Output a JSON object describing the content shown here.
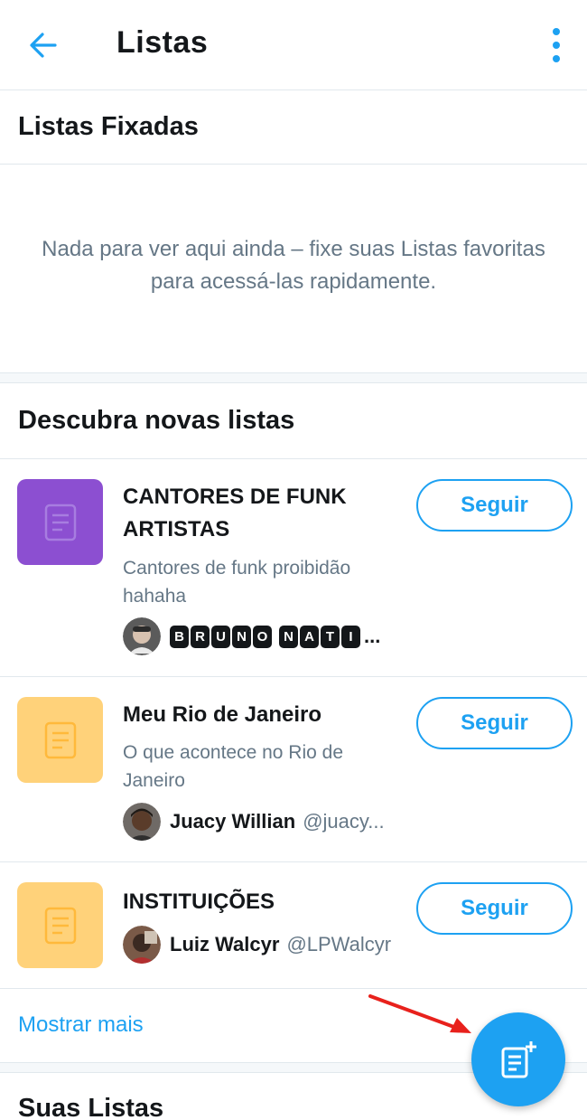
{
  "header": {
    "title": "Listas",
    "back_icon": "back-arrow-icon",
    "menu_icon": "more-vertical-icon"
  },
  "pinned": {
    "title": "Listas Fixadas",
    "empty_message": "Nada para ver aqui ainda – fixe suas Listas favoritas para acessá-las rapidamente."
  },
  "discover": {
    "title": "Descubra novas listas",
    "follow_label": "Seguir",
    "items": [
      {
        "name": "CANTORES DE FUNK ARTISTAS",
        "description": "Cantores de funk proibidão hahaha",
        "owner_letters": [
          "B",
          "R",
          "U",
          "N",
          "O",
          "N",
          "A",
          "T",
          "I"
        ],
        "owner_ellipsis": "...",
        "thumb_color": "#8c4fd1"
      },
      {
        "name": "Meu Rio de Janeiro",
        "description": "O que acontece no Rio de Janeiro",
        "owner_name": "Juacy Willian",
        "owner_handle": "@juacy...",
        "thumb_color": "#ffd27a"
      },
      {
        "name": "INSTITUIÇÕES",
        "owner_name": "Luiz Walcyr",
        "owner_handle": "@LPWalcyr",
        "thumb_color": "#ffd27a"
      }
    ],
    "show_more": "Mostrar mais"
  },
  "your_lists": {
    "title": "Suas Listas"
  },
  "fab": {
    "icon": "new-list-icon"
  },
  "colors": {
    "accent": "#1da1f2",
    "text_primary": "#14171a",
    "text_secondary": "#657786",
    "divider": "#e1e8ed",
    "annotation_arrow": "#e8211c"
  }
}
